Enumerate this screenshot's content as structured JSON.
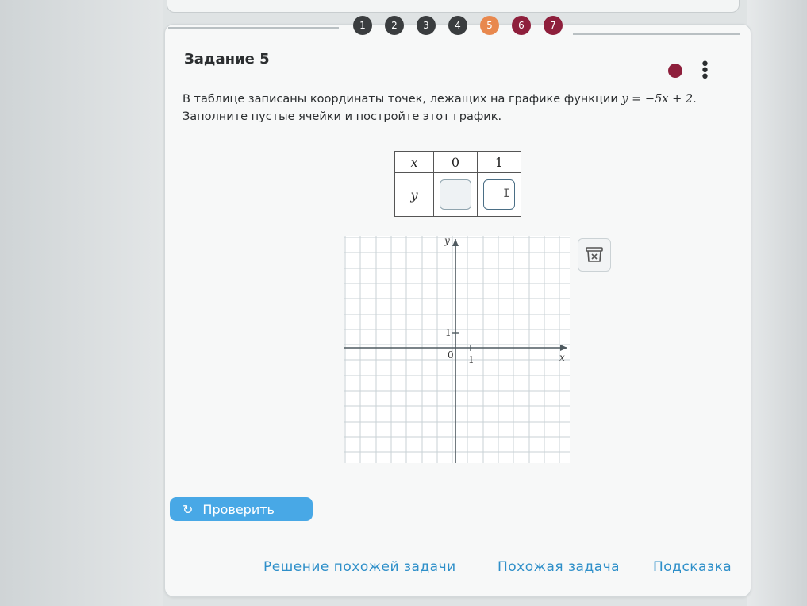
{
  "steps": [
    {
      "label": "1",
      "state": "done"
    },
    {
      "label": "2",
      "state": "done"
    },
    {
      "label": "3",
      "state": "done"
    },
    {
      "label": "4",
      "state": "done"
    },
    {
      "label": "5",
      "state": "current"
    },
    {
      "label": "6",
      "state": "bad"
    },
    {
      "label": "7",
      "state": "bad"
    }
  ],
  "task": {
    "title": "Задание 5",
    "text_line1_prefix": "В таблице записаны координаты точек, лежащих на графике функции ",
    "formula": "y = −5x + 2",
    "text_line1_suffix": ".",
    "text_line2": "Заполните пустые ячейки и постройте этот график."
  },
  "table": {
    "x_label": "x",
    "y_label": "y",
    "x_values": [
      "0",
      "1"
    ],
    "y_values": [
      "",
      ""
    ]
  },
  "graph": {
    "y_axis_label": "y",
    "x_axis_label": "x",
    "origin_label": "0",
    "x_tick_label": "1",
    "y_tick_label": "1"
  },
  "buttons": {
    "check": "Проверить"
  },
  "links": {
    "similar_solution": "Решение похожей задачи",
    "similar_task": "Похожая задача",
    "hint": "Подсказка"
  }
}
